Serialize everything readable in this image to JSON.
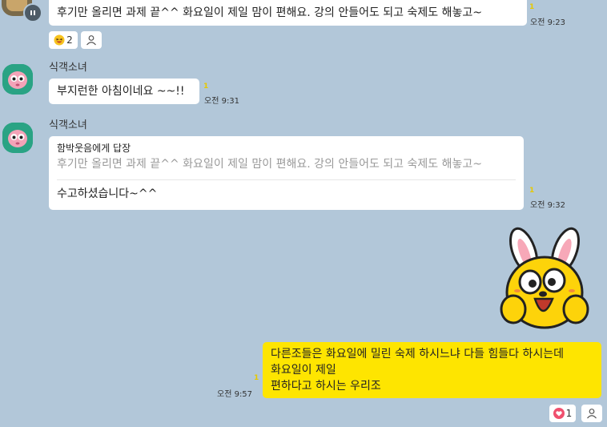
{
  "messages": {
    "m1": {
      "text": "후기만 올리면 과제 끝^^ 화요일이 제일 맘이 편해요. 강의 안들어도 되고 숙제도 해놓고~",
      "unread": "1",
      "time": "오전 9:23",
      "reaction_count": "2"
    },
    "m2": {
      "sender": "식객소녀",
      "text": "부지런한 아침이네요 ~~!!",
      "unread": "1",
      "time": "오전 9:31"
    },
    "m3": {
      "sender": "식객소녀",
      "reply_to": "함박웃음에게 답장",
      "quoted": "후기만 올리면 과제 끝^^ 화요일이 제일 맘이 편해요. 강의 안들어도 되고 숙제도 해놓고~",
      "text": "수고하셨습니다~^^",
      "unread": "1",
      "time": "오전 9:32"
    },
    "m5": {
      "line1": "다른조들은 화요일에 밀린 숙제 하시느냐 다들 힘들다 하시는데",
      "line2": "화요일이 제일",
      "line3": "편하다고 하시는 우리조",
      "unread": "1",
      "time": "오전 9:57",
      "reaction_count": "1"
    }
  },
  "icons": {
    "laugh_reaction": "laughing-emoji-icon",
    "heart_reaction": "heart-icon",
    "person": "person-icon",
    "sticker": "rabbit-sticker",
    "avatar": "pink-character-avatar"
  },
  "colors": {
    "background": "#b2c7d9",
    "my_bubble": "#fee500",
    "other_bubble": "#ffffff",
    "avatar_bg": "#2aa384",
    "unread": "#e6c800"
  }
}
